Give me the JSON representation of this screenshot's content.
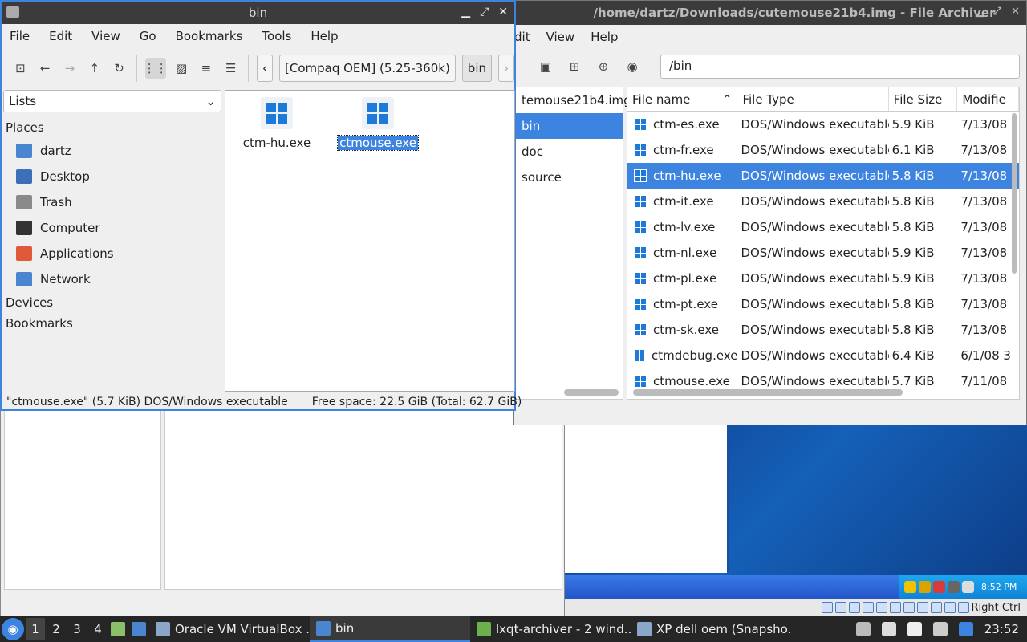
{
  "file_manager": {
    "title": "bin",
    "menu": [
      "File",
      "Edit",
      "View",
      "Go",
      "Bookmarks",
      "Tools",
      "Help"
    ],
    "breadcrumb": {
      "device": "[Compaq OEM] (5.25-360k)",
      "current": "bin"
    },
    "side_view_mode": "Lists",
    "places_label": "Places",
    "places": [
      {
        "label": "dartz",
        "icon": "home-folder-icon",
        "color": "#4a86cf"
      },
      {
        "label": "Desktop",
        "icon": "desktop-icon",
        "color": "#3d6fb8"
      },
      {
        "label": "Trash",
        "icon": "trash-icon",
        "color": "#8a8a8a"
      },
      {
        "label": "Computer",
        "icon": "computer-icon",
        "color": "#333333"
      },
      {
        "label": "Applications",
        "icon": "applications-icon",
        "color": "#e05a3a"
      },
      {
        "label": "Network",
        "icon": "network-icon",
        "color": "#4a86cf"
      }
    ],
    "devices_label": "Devices",
    "bookmarks_label": "Bookmarks",
    "files": [
      {
        "name": "ctm-hu.exe",
        "selected": false
      },
      {
        "name": "ctmouse.exe",
        "selected": true
      }
    ],
    "status": {
      "selection": "\"ctmouse.exe\" (5.7 KiB) DOS/Windows executable",
      "free": "Free space: 22.5 GiB (Total: 62.7 GiB)"
    }
  },
  "archiver": {
    "title": "/home/dartz/Downloads/cutemouse21b4.img - File Archiver",
    "menu": [
      "dit",
      "View",
      "Help"
    ],
    "path": "/bin",
    "tree": [
      {
        "label": "temouse21b4.img",
        "selected": false
      },
      {
        "label": "bin",
        "selected": true
      },
      {
        "label": "doc",
        "selected": false
      },
      {
        "label": "source",
        "selected": false
      }
    ],
    "columns": [
      "File name",
      "File Type",
      "File Size",
      "Modifie"
    ],
    "rows": [
      {
        "name": "ctm-es.exe",
        "type": "DOS/Windows executable",
        "size": "5.9 KiB",
        "mod": "7/13/08",
        "selected": false
      },
      {
        "name": "ctm-fr.exe",
        "type": "DOS/Windows executable",
        "size": "6.1 KiB",
        "mod": "7/13/08",
        "selected": false
      },
      {
        "name": "ctm-hu.exe",
        "type": "DOS/Windows executable",
        "size": "5.8 KiB",
        "mod": "7/13/08",
        "selected": true
      },
      {
        "name": "ctm-it.exe",
        "type": "DOS/Windows executable",
        "size": "5.8 KiB",
        "mod": "7/13/08",
        "selected": false
      },
      {
        "name": "ctm-lv.exe",
        "type": "DOS/Windows executable",
        "size": "5.8 KiB",
        "mod": "7/13/08",
        "selected": false
      },
      {
        "name": "ctm-nl.exe",
        "type": "DOS/Windows executable",
        "size": "5.9 KiB",
        "mod": "7/13/08",
        "selected": false
      },
      {
        "name": "ctm-pl.exe",
        "type": "DOS/Windows executable",
        "size": "5.9 KiB",
        "mod": "7/13/08",
        "selected": false
      },
      {
        "name": "ctm-pt.exe",
        "type": "DOS/Windows executable",
        "size": "5.8 KiB",
        "mod": "7/13/08",
        "selected": false
      },
      {
        "name": "ctm-sk.exe",
        "type": "DOS/Windows executable",
        "size": "5.8 KiB",
        "mod": "7/13/08",
        "selected": false
      },
      {
        "name": "ctmdebug.exe",
        "type": "DOS/Windows executable",
        "size": "6.4 KiB",
        "mod": "6/1/08 3",
        "selected": false
      },
      {
        "name": "ctmouse.exe",
        "type": "DOS/Windows executable",
        "size": "5.7 KiB",
        "mod": "7/11/08",
        "selected": false
      }
    ]
  },
  "vm": {
    "xp_clock": "8:52 PM",
    "host_key": "Right Ctrl"
  },
  "panel": {
    "workspaces": [
      "1",
      "2",
      "3",
      "4"
    ],
    "tasks": [
      {
        "label": "Oracle VM VirtualBox ...",
        "icon": "virtualbox-icon",
        "color": "#8aa6c8",
        "active": false
      },
      {
        "label": "bin",
        "icon": "folder-icon",
        "color": "#4a86cf",
        "active": true
      },
      {
        "label": "lxqt-archiver - 2 wind...",
        "icon": "archive-icon",
        "color": "#6ab04c",
        "active": false
      },
      {
        "label": "XP dell oem (Snapsho...",
        "icon": "vm-icon",
        "color": "#8aa6c8",
        "active": false
      }
    ],
    "clock": "23:52"
  },
  "colors": {
    "accent": "#3d84e0",
    "titlebar": "#3b3b3b",
    "panel": "#262626"
  }
}
